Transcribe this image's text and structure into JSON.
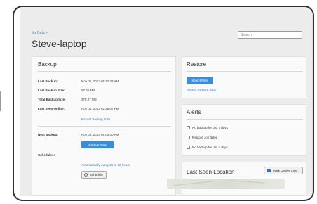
{
  "header": {
    "breadcrumb": "My Data >",
    "title": "Steve-laptop",
    "search_placeholder": "Search"
  },
  "backup": {
    "title": "Backup",
    "rows": [
      {
        "label": "Last Backup:",
        "value": "Nov 05, 2013 09:42:32 AM"
      },
      {
        "label": "Last Backup Size:",
        "value": "57.85 MB"
      },
      {
        "label": "Total Backup Size:",
        "value": "378.07 MB"
      },
      {
        "label": "Last Seen Online:",
        "value": "Nov 05, 2013 02:58:07 PM"
      }
    ],
    "recent_jobs_link": "Recent Backup Jobs",
    "next_backup_label": "Next Backup:",
    "next_backup_value": "Nov 05, 2013 09:00:00 PM",
    "backup_now_label": "Backup Now",
    "schedules_label": "Schedules:",
    "schedule_text": "Automatically every 36 to 72 hours",
    "schedule_button": "Schedule"
  },
  "restore": {
    "title": "Restore",
    "select_files_label": "Select Files",
    "recent_jobs_link": "Recent Restore Jobs"
  },
  "alerts": {
    "title": "Alerts",
    "items": [
      "No backup for last 7 days",
      "Restore Job failed",
      "No backup for last 4 days"
    ]
  },
  "location": {
    "title": "Last Seen Location",
    "mark_lost_label": "Mark Device Lost"
  },
  "colors": {
    "accent": "#3b8ed6",
    "link": "#3a7bc8"
  }
}
